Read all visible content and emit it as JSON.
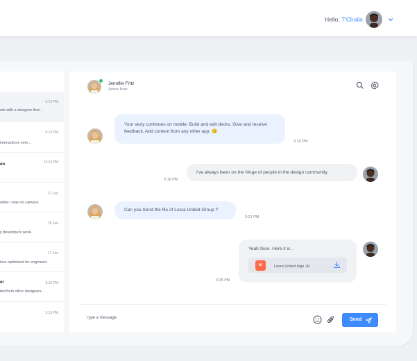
{
  "header": {
    "greeting": "Hello,",
    "user_name": "T'Challa"
  },
  "conversations": [
    {
      "time": "3:15 PM",
      "name": "",
      "preview": "ork with a designer that..."
    },
    {
      "time": "5:15 PM",
      "name": "",
      "preview": "interactions over..."
    },
    {
      "time": "11:15 PM",
      "name": "en",
      "preview": ""
    },
    {
      "time": "21 Jan",
      "name": "",
      "preview": "while I was on campus"
    },
    {
      "time": "20 Jan",
      "name": "",
      "preview": "y developers work."
    },
    {
      "time": "17 Jan",
      "name": "",
      "preview": "ture optimized for engineers"
    },
    {
      "time": "3:15 PM",
      "name": "er",
      "preview": "ted from other designers..."
    },
    {
      "time": "3:15 PM",
      "name": "",
      "preview": ""
    }
  ],
  "chat": {
    "contact_name": "Jennifer Fritz",
    "contact_status": "Active Now",
    "messages": [
      {
        "direction": "in",
        "text": "Your story continues on mobile: Build and edit decks. Give and receive feedback. Add content from any other app. 😊",
        "time": "3:15 PM"
      },
      {
        "direction": "out",
        "text": "I've always been on the fringe of people in the design community.",
        "time": "3:18 PM"
      },
      {
        "direction": "in",
        "text": "Can you Send the file of Losra United Group ?",
        "time": "3:21 PM"
      },
      {
        "direction": "out",
        "text": "Yeah Sure. Here it is .",
        "time": "3:25 PM",
        "attachment": {
          "badge": "AI",
          "file_name": "Losra United logo .AI"
        }
      }
    ]
  },
  "composer": {
    "placeholder": "Type a message",
    "send_label": "Send"
  },
  "colors": {
    "accent": "#3d8bff",
    "incoming_bubble": "#eaf2ff",
    "outgoing_bubble": "#f1f2f4",
    "online": "#27c267",
    "ai_badge": "#ff6b4a"
  },
  "icons": [
    "search-icon",
    "gear-icon",
    "smiley-icon",
    "paperclip-icon",
    "send-icon",
    "download-icon",
    "chevron-down-icon"
  ]
}
